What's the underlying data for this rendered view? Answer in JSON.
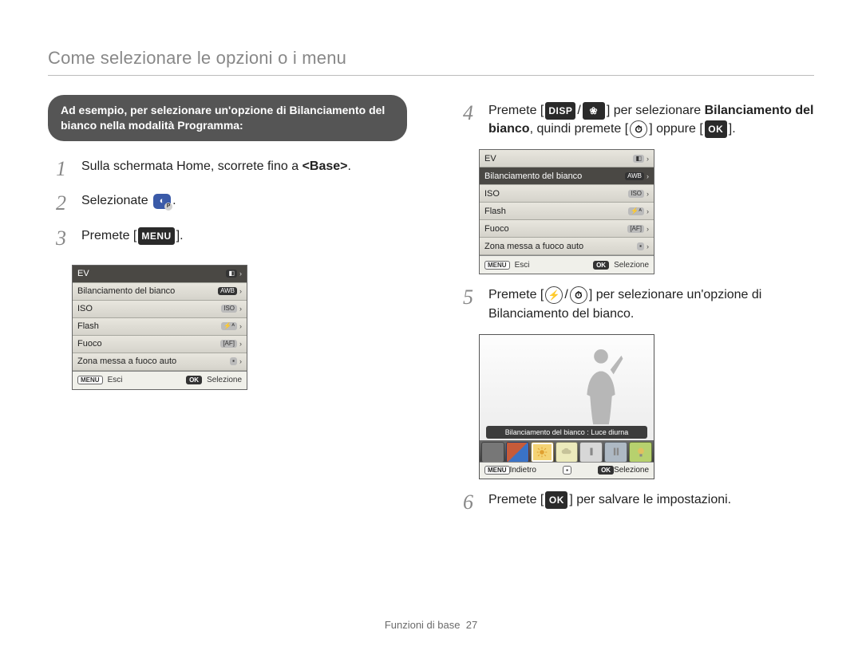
{
  "title": "Come selezionare le opzioni o i menu",
  "callout": "Ad esempio, per selezionare un'opzione di Bilanciamento del bianco nella modalità Programma:",
  "labels": {
    "menu": "MENU",
    "disp": "DISP",
    "macro": "❀",
    "timer": "⏱",
    "ok": "OK",
    "flash": "⚡",
    "program_icon": "◐",
    "program_badge": "P"
  },
  "steps": [
    {
      "n": "1",
      "text_before": "Sulla schermata Home, scorrete fino a ",
      "bold": "<Base>",
      "text_after": "."
    },
    {
      "n": "2",
      "text_before": "Selezionate ",
      "after_icon": "."
    },
    {
      "n": "3",
      "text_before": "Premete [",
      "icon_key": "menu",
      "text_after": "]."
    },
    {
      "n": "4",
      "text_before": "Premete [",
      "icons": [
        "disp",
        "/",
        "macro"
      ],
      "mid": "] per selezionare ",
      "bold": "Bilanciamento del bianco",
      "mid2": ", quindi premete [",
      "icon2": "timer",
      "mid3": "] oppure [",
      "icon3": "ok",
      "text_after": "]."
    },
    {
      "n": "5",
      "text_before": "Premete [",
      "icons": [
        "flash",
        "/",
        "timer"
      ],
      "text_after": "] per selezionare un'opzione di Bilanciamento del bianco."
    },
    {
      "n": "6",
      "text_before": "Premete [",
      "icon_key": "ok",
      "text_after": "] per salvare le impostazioni."
    }
  ],
  "menu_box": {
    "rows": [
      {
        "label": "EV",
        "badge": "◧"
      },
      {
        "label": "Bilanciamento del bianco",
        "badge": "AWB"
      },
      {
        "label": "ISO",
        "badge": "ISO"
      },
      {
        "label": "Flash",
        "badge": "⚡ᴬ"
      },
      {
        "label": "Fuoco",
        "badge": "[AF]"
      },
      {
        "label": "Zona messa a fuoco auto",
        "badge": "▪"
      }
    ],
    "footer_left_btn": "MENU",
    "footer_left": "Esci",
    "footer_right_btn": "OK",
    "footer_right": "Selezione",
    "selected_index_a": 0,
    "selected_index_b": 1
  },
  "wb_preview": {
    "caption": "Bilanciamento del bianco : Luce diurna",
    "chip_colors": [
      "#777",
      "#c65b3a,#3a73c6",
      "#f4d374",
      "#eceabc",
      "#d7d7d7",
      "#aeb9c4",
      "#b7d16e"
    ],
    "selected_chip": 2,
    "footer_left_btn": "MENU",
    "footer_left": "Indietro",
    "footer_mid_btn": "▪",
    "footer_right_btn": "OK",
    "footer_right": "Selezione"
  },
  "page_footer": {
    "section": "Funzioni di base",
    "page": "27"
  }
}
